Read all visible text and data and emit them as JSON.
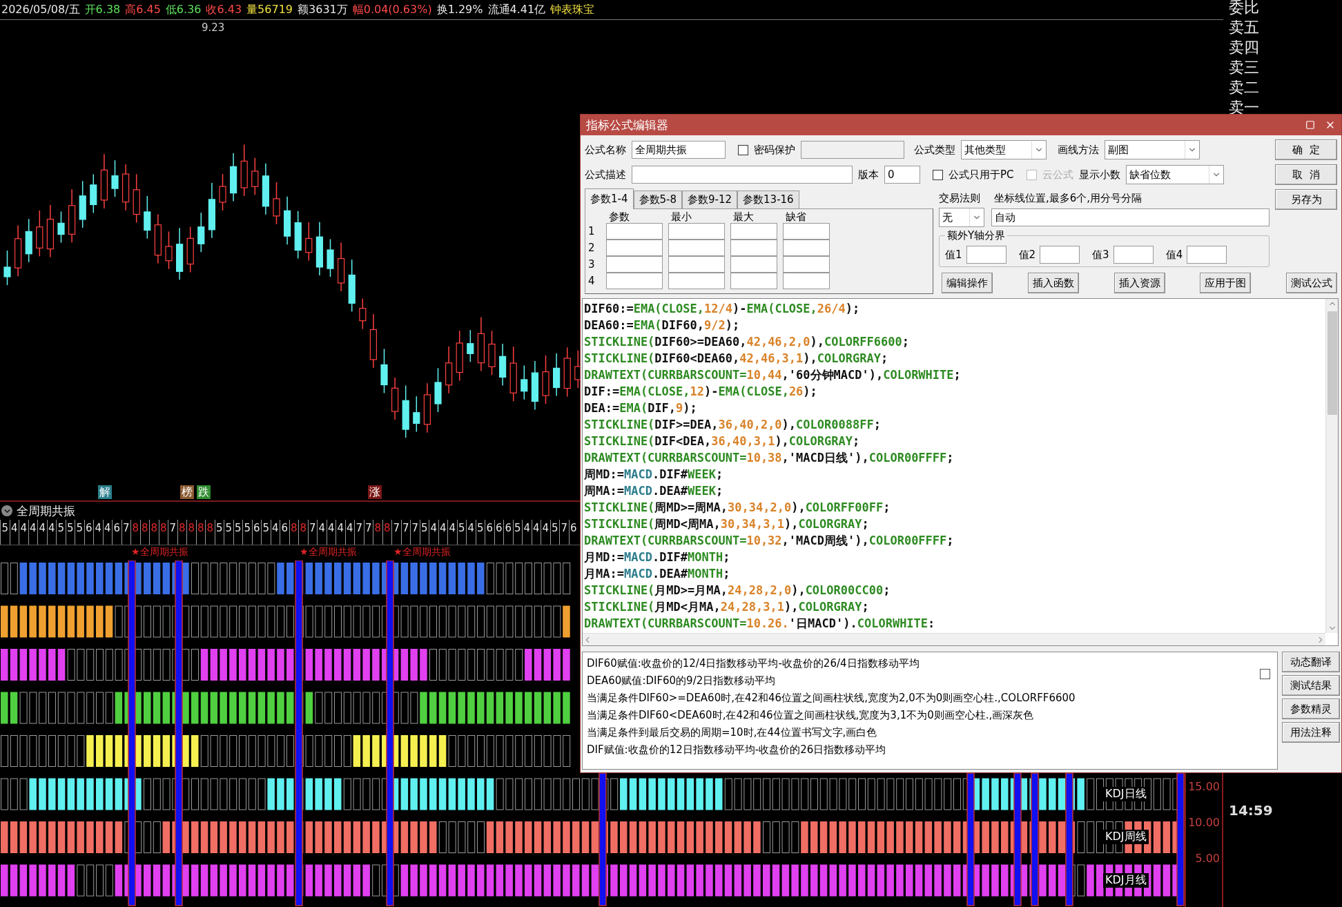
{
  "quote_bar": {
    "items": [
      {
        "text": "2026/05/08/五",
        "color": "#e8e8e8"
      },
      {
        "text": "开6.38",
        "color": "#5ee05e"
      },
      {
        "text": "高6.45",
        "color": "#ff4a4a"
      },
      {
        "text": "低6.36",
        "color": "#5ee05e"
      },
      {
        "text": "收6.43",
        "color": "#ff4a4a"
      },
      {
        "text": "量56719",
        "color": "#f0e040"
      },
      {
        "text": "额3631万",
        "color": "#e8e8e8"
      },
      {
        "text": "幅0.04(0.63%)",
        "color": "#ff4a4a"
      },
      {
        "text": "换1.29%",
        "color": "#e8e8e8"
      },
      {
        "text": "流通4.41亿",
        "color": "#e8e8e8"
      },
      {
        "text": "钟表珠宝",
        "color": "#f0e040"
      }
    ]
  },
  "price_chart": {
    "high_label": "9.23"
  },
  "event_markers": [
    {
      "text": "解",
      "color": "#2a7f8c"
    },
    {
      "text": "榜",
      "color": "#8c5a30"
    },
    {
      "text": "跌",
      "color": "#2f8c2f"
    },
    {
      "text": "涨",
      "color": "#7a1616"
    }
  ],
  "indicator": {
    "title": "全周期共振",
    "counts": [
      {
        "text": "5",
        "highlighted": false
      },
      {
        "text": "4",
        "highlighted": false
      },
      {
        "text": "4",
        "highlighted": false
      },
      {
        "text": "4",
        "highlighted": false
      },
      {
        "text": "4",
        "highlighted": false
      },
      {
        "text": "4",
        "highlighted": false
      },
      {
        "text": "5",
        "highlighted": false
      },
      {
        "text": "5",
        "highlighted": false
      },
      {
        "text": "5",
        "highlighted": false
      },
      {
        "text": "6",
        "highlighted": false
      },
      {
        "text": "4",
        "highlighted": false
      },
      {
        "text": "4",
        "highlighted": false
      },
      {
        "text": "6",
        "highlighted": false
      },
      {
        "text": "7",
        "highlighted": false
      },
      {
        "text": "8",
        "highlighted": true
      },
      {
        "text": "8",
        "highlighted": true
      },
      {
        "text": "8",
        "highlighted": true
      },
      {
        "text": "8",
        "highlighted": true
      },
      {
        "text": "7",
        "highlighted": false
      },
      {
        "text": "8",
        "highlighted": true
      },
      {
        "text": "8",
        "highlighted": true
      },
      {
        "text": "8",
        "highlighted": true
      },
      {
        "text": "8",
        "highlighted": true
      },
      {
        "text": "5",
        "highlighted": false
      },
      {
        "text": "5",
        "highlighted": false
      },
      {
        "text": "5",
        "highlighted": false
      },
      {
        "text": "5",
        "highlighted": false
      },
      {
        "text": "6",
        "highlighted": false
      },
      {
        "text": "5",
        "highlighted": false
      },
      {
        "text": "4",
        "highlighted": false
      },
      {
        "text": "6",
        "highlighted": false
      },
      {
        "text": "8",
        "highlighted": true
      },
      {
        "text": "8",
        "highlighted": true
      },
      {
        "text": "7",
        "highlighted": false
      },
      {
        "text": "4",
        "highlighted": false
      },
      {
        "text": "4",
        "highlighted": false
      },
      {
        "text": "4",
        "highlighted": false
      },
      {
        "text": "4",
        "highlighted": false
      },
      {
        "text": "7",
        "highlighted": false
      },
      {
        "text": "7",
        "highlighted": false
      },
      {
        "text": "8",
        "highlighted": true
      },
      {
        "text": "8",
        "highlighted": true
      },
      {
        "text": "7",
        "highlighted": false
      },
      {
        "text": "7",
        "highlighted": false
      },
      {
        "text": "7",
        "highlighted": false
      },
      {
        "text": "5",
        "highlighted": false
      },
      {
        "text": "4",
        "highlighted": false
      },
      {
        "text": "4",
        "highlighted": false
      },
      {
        "text": "4",
        "highlighted": false
      },
      {
        "text": "5",
        "highlighted": false
      },
      {
        "text": "4",
        "highlighted": false
      },
      {
        "text": "5",
        "highlighted": false
      },
      {
        "text": "6",
        "highlighted": false
      },
      {
        "text": "6",
        "highlighted": false
      },
      {
        "text": "6",
        "highlighted": false
      },
      {
        "text": "5",
        "highlighted": false
      },
      {
        "text": "4",
        "highlighted": false
      },
      {
        "text": "4",
        "highlighted": false
      },
      {
        "text": "4",
        "highlighted": false
      },
      {
        "text": "5",
        "highlighted": false
      },
      {
        "text": "7",
        "highlighted": false
      },
      {
        "text": "6",
        "highlighted": false
      }
    ],
    "signals": [
      "★全周期共振",
      "★全周期共振",
      "★全周期共振"
    ],
    "rows": [
      {
        "color": "#3a6ee6"
      },
      {
        "color": "#f0a030"
      },
      {
        "color": "#e040f0"
      },
      {
        "color": "#50d040"
      },
      {
        "color": "#f5f050"
      },
      {
        "color": "#60f0f0",
        "label": "KDJ日线"
      },
      {
        "color": "#f06e64",
        "label": "KDJ周线"
      },
      {
        "color": "#e040f0",
        "label": "KDJ月线"
      }
    ],
    "axis_ticks": [
      "15.00",
      "10.00",
      "5.00"
    ]
  },
  "order_book": {
    "labels": [
      "委比",
      "卖五",
      "卖四",
      "卖三",
      "卖二",
      "卖一"
    ],
    "time": "14:59"
  },
  "editor": {
    "title": "指标公式编辑器",
    "name": {
      "label": "公式名称",
      "value": "全周期共振"
    },
    "password": {
      "label": "密码保护",
      "checked": false
    },
    "formula_type": {
      "label": "公式类型",
      "value": "其他类型"
    },
    "draw_method": {
      "label": "画线方法",
      "value": "副图"
    },
    "description": {
      "label": "公式描述"
    },
    "version": {
      "label": "版本",
      "value": "0"
    },
    "pc_only": {
      "label": "公式只用于PC",
      "checked": false,
      "disabled": false
    },
    "cloud": {
      "label": "云公式",
      "checked": false,
      "disabled": true
    },
    "decimals": {
      "label": "显示小数",
      "value": "缺省位数"
    },
    "side_buttons": [
      "确  定",
      "取  消",
      "另存为"
    ],
    "param_tabs": [
      {
        "label": "参数1-4",
        "selected": true
      },
      {
        "label": "参数5-8",
        "selected": false
      },
      {
        "label": "参数9-12",
        "selected": false
      },
      {
        "label": "参数13-16",
        "selected": false
      }
    ],
    "param_columns": [
      "参数",
      "最小",
      "最大",
      "缺省"
    ],
    "param_rows": [
      "1",
      "2",
      "3",
      "4"
    ],
    "trade_rule": {
      "label": "交易法则",
      "value": "无"
    },
    "axis_lines": {
      "label": "坐标线位置,最多6个,用分号分隔",
      "value": "自动"
    },
    "y_split": {
      "title": "额外Y轴分界",
      "fields": [
        "值1",
        "值2",
        "值3",
        "值4"
      ]
    },
    "actions": [
      "编辑操作",
      "插入函数",
      "插入资源",
      "应用于图",
      "测试公式"
    ],
    "code": [
      [
        {
          "kind": "plain",
          "text": "DIF60:="
        },
        {
          "kind": "function",
          "text": "EMA(CLOSE,"
        },
        {
          "kind": "number",
          "text": "12/4"
        },
        {
          "kind": "plain",
          "text": ")-"
        },
        {
          "kind": "function",
          "text": "EMA(CLOSE,"
        },
        {
          "kind": "number",
          "text": "26/4"
        },
        {
          "kind": "plain",
          "text": ");"
        }
      ],
      [
        {
          "kind": "plain",
          "text": "DEA60:="
        },
        {
          "kind": "function",
          "text": "EMA("
        },
        {
          "kind": "plain",
          "text": "DIF60,"
        },
        {
          "kind": "number",
          "text": "9/2"
        },
        {
          "kind": "plain",
          "text": ");"
        }
      ],
      [
        {
          "kind": "function",
          "text": "STICKLINE("
        },
        {
          "kind": "plain",
          "text": "DIF60>=DEA60,"
        },
        {
          "kind": "number",
          "text": "42,46,2,0"
        },
        {
          "kind": "plain",
          "text": "),"
        },
        {
          "kind": "function",
          "text": "COLORFF6600"
        },
        {
          "kind": "plain",
          "text": ";"
        }
      ],
      [
        {
          "kind": "function",
          "text": "STICKLINE("
        },
        {
          "kind": "plain",
          "text": "DIF60<DEA60,"
        },
        {
          "kind": "number",
          "text": "42,46,3,1"
        },
        {
          "kind": "plain",
          "text": "),"
        },
        {
          "kind": "function",
          "text": "COLORGRAY"
        },
        {
          "kind": "plain",
          "text": ";"
        }
      ],
      [
        {
          "kind": "function",
          "text": "DRAWTEXT(CURRBARSCOUNT="
        },
        {
          "kind": "number",
          "text": "10,44"
        },
        {
          "kind": "plain",
          "text": ",'60分钟MACD'),"
        },
        {
          "kind": "function",
          "text": "COLORWHITE"
        },
        {
          "kind": "plain",
          "text": ";"
        }
      ],
      [
        {
          "kind": "plain",
          "text": "DIF:="
        },
        {
          "kind": "function",
          "text": "EMA(CLOSE,"
        },
        {
          "kind": "number",
          "text": "12"
        },
        {
          "kind": "plain",
          "text": ")-"
        },
        {
          "kind": "function",
          "text": "EMA(CLOSE,"
        },
        {
          "kind": "number",
          "text": "26"
        },
        {
          "kind": "plain",
          "text": ");"
        }
      ],
      [
        {
          "kind": "plain",
          "text": "DEA:="
        },
        {
          "kind": "function",
          "text": "EMA("
        },
        {
          "kind": "plain",
          "text": "DIF,"
        },
        {
          "kind": "number",
          "text": "9"
        },
        {
          "kind": "plain",
          "text": ");"
        }
      ],
      [
        {
          "kind": "function",
          "text": "STICKLINE("
        },
        {
          "kind": "plain",
          "text": "DIF>=DEA,"
        },
        {
          "kind": "number",
          "text": "36,40,2,0"
        },
        {
          "kind": "plain",
          "text": "),"
        },
        {
          "kind": "function",
          "text": "COLOR0088FF"
        },
        {
          "kind": "plain",
          "text": ";"
        }
      ],
      [
        {
          "kind": "function",
          "text": "STICKLINE("
        },
        {
          "kind": "plain",
          "text": "DIF<DEA,"
        },
        {
          "kind": "number",
          "text": "36,40,3,1"
        },
        {
          "kind": "plain",
          "text": "),"
        },
        {
          "kind": "function",
          "text": "COLORGRAY"
        },
        {
          "kind": "plain",
          "text": ";"
        }
      ],
      [
        {
          "kind": "function",
          "text": "DRAWTEXT(CURRBARSCOUNT="
        },
        {
          "kind": "number",
          "text": "10,38"
        },
        {
          "kind": "plain",
          "text": ",'MACD日线'),"
        },
        {
          "kind": "function",
          "text": "COLOR00FFFF"
        },
        {
          "kind": "plain",
          "text": ";"
        }
      ],
      [
        {
          "kind": "plain",
          "text": "周MD:="
        },
        {
          "kind": "reference",
          "text": "MACD"
        },
        {
          "kind": "plain",
          "text": ".DIF#"
        },
        {
          "kind": "function",
          "text": "WEEK"
        },
        {
          "kind": "plain",
          "text": ";"
        }
      ],
      [
        {
          "kind": "plain",
          "text": "周MA:="
        },
        {
          "kind": "reference",
          "text": "MACD"
        },
        {
          "kind": "plain",
          "text": ".DEA#"
        },
        {
          "kind": "function",
          "text": "WEEK"
        },
        {
          "kind": "plain",
          "text": ";"
        }
      ],
      [
        {
          "kind": "function",
          "text": "STICKLINE("
        },
        {
          "kind": "plain",
          "text": "周MD>=周MA,"
        },
        {
          "kind": "number",
          "text": "30,34,2,0"
        },
        {
          "kind": "plain",
          "text": "),"
        },
        {
          "kind": "function",
          "text": "COLORFF00FF"
        },
        {
          "kind": "plain",
          "text": ";"
        }
      ],
      [
        {
          "kind": "function",
          "text": "STICKLINE("
        },
        {
          "kind": "plain",
          "text": "周MD<周MA,"
        },
        {
          "kind": "number",
          "text": "30,34,3,1"
        },
        {
          "kind": "plain",
          "text": "),"
        },
        {
          "kind": "function",
          "text": "COLORGRAY"
        },
        {
          "kind": "plain",
          "text": ";"
        }
      ],
      [
        {
          "kind": "function",
          "text": "DRAWTEXT(CURRBARSCOUNT="
        },
        {
          "kind": "number",
          "text": "10,32"
        },
        {
          "kind": "plain",
          "text": ",'MACD周线'),"
        },
        {
          "kind": "function",
          "text": "COLOR00FFFF"
        },
        {
          "kind": "plain",
          "text": ";"
        }
      ],
      [
        {
          "kind": "plain",
          "text": "月MD:="
        },
        {
          "kind": "reference",
          "text": "MACD"
        },
        {
          "kind": "plain",
          "text": ".DIF#"
        },
        {
          "kind": "function",
          "text": "MONTH"
        },
        {
          "kind": "plain",
          "text": ";"
        }
      ],
      [
        {
          "kind": "plain",
          "text": "月MA:="
        },
        {
          "kind": "reference",
          "text": "MACD"
        },
        {
          "kind": "plain",
          "text": ".DEA#"
        },
        {
          "kind": "function",
          "text": "MONTH"
        },
        {
          "kind": "plain",
          "text": ";"
        }
      ],
      [
        {
          "kind": "function",
          "text": "STICKLINE("
        },
        {
          "kind": "plain",
          "text": "月MD>=月MA,"
        },
        {
          "kind": "number",
          "text": "24,28,2,0"
        },
        {
          "kind": "plain",
          "text": "),"
        },
        {
          "kind": "function",
          "text": "COLOR00CC00"
        },
        {
          "kind": "plain",
          "text": ";"
        }
      ],
      [
        {
          "kind": "function",
          "text": "STICKLINE("
        },
        {
          "kind": "plain",
          "text": "月MD<月MA,"
        },
        {
          "kind": "number",
          "text": "24,28,3,1"
        },
        {
          "kind": "plain",
          "text": "),"
        },
        {
          "kind": "function",
          "text": "COLORGRAY"
        },
        {
          "kind": "plain",
          "text": ";"
        }
      ],
      [
        {
          "kind": "function",
          "text": "DRAWTEXT(CURRBARSCOUNT="
        },
        {
          "kind": "number",
          "text": "10.26."
        },
        {
          "kind": "plain",
          "text": "'日MACD')."
        },
        {
          "kind": "function",
          "text": "COLORWHITE"
        },
        {
          "kind": "plain",
          "text": ":"
        }
      ]
    ],
    "notes": [
      "DIF60赋值:收盘价的12/4日指数移动平均-收盘价的26/4日指数移动平均",
      "DEA60赋值:DIF60的9/2日指数移动平均",
      "当满足条件DIF60>=DEA60时,在42和46位置之间画柱状线,宽度为2,0不为0则画空心柱.,COLORFF6600",
      "当满足条件DIF60<DEA60时,在42和46位置之间画柱状线,宽度为3,1不为0则画空心柱.,画深灰色",
      "当满足条件到最后交易的周期=10时,在44位置书写文字,画白色",
      "DIF赋值:收盘价的12日指数移动平均-收盘价的26日指数移动平均"
    ],
    "notes_option": {
      "checked": false
    },
    "note_buttons": [
      "动态翻译",
      "测试结果",
      "参数精灵",
      "用法注释"
    ]
  }
}
